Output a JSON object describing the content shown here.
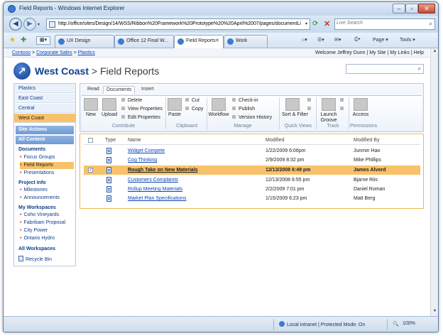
{
  "browser": {
    "window_title": "Field Reports - Windows Internet Explorer",
    "url": "http://office/sites/Design/14/WSS/Ribbon%20Framework%20Prototype%20%20April%2007/pages/documentLi",
    "search_placeholder": "Live Search",
    "tabs": [
      {
        "label": "UX Design"
      },
      {
        "label": "Office 12 Final W..."
      },
      {
        "label": "Field Reports"
      },
      {
        "label": "Work"
      }
    ],
    "commands": {
      "page": "Page ▾",
      "tools": "Tools ▾"
    },
    "status": {
      "zone": "Local intranet | Protected Mode: On",
      "zoom": "100%"
    }
  },
  "site": {
    "breadcrumb": [
      "Contoso",
      "Corporate Sales",
      "Plastics"
    ],
    "breadcrumb_sep": ">",
    "welcome": "Welcome Jeffrey Dunn | My Site | My Links | Help",
    "title_site": "West Coast",
    "title_page": " > Field Reports"
  },
  "leftnav": {
    "sites": [
      "Plastics",
      "East Coast",
      "Central",
      "West Coast"
    ],
    "site_actions": "Site Actions",
    "all_content": "All Content",
    "documents_head": "Documents",
    "documents": [
      "Focus Groups",
      "Field Reports",
      "Presentations"
    ],
    "project_head": "Project Info",
    "project": [
      "Milestones",
      "Announcements"
    ],
    "workspaces_head": "My Workspaces",
    "workspaces": [
      "Coho Vineyards",
      "Fabrikam Proposal",
      "City Power",
      "Ontario Hydro"
    ],
    "all_workspaces": "All Workspaces",
    "recycle_bin": "Recycle Bin"
  },
  "ribbon": {
    "tabs": [
      "Read",
      "Documents",
      "Insert"
    ],
    "new": "New",
    "upload": "Upload",
    "delete": "Delete",
    "view_properties": "View Properties",
    "edit_properties": "Edit Properties",
    "paste": "Paste",
    "cut": "Cut",
    "copy": "Copy",
    "workflow": "Workflow",
    "check_in": "Check-in",
    "publish": "Publish",
    "version_history": "Version History",
    "sort_filter": "Sort & Filter",
    "launch_groove": "Launch Groove",
    "access": "Access",
    "groups": [
      "Contribute",
      "Clipboard",
      "Manage",
      "Quick Views",
      "Track",
      "Permissions"
    ]
  },
  "list": {
    "columns": [
      "Type",
      "Name",
      "Modified",
      "Modified By"
    ],
    "rows": [
      {
        "name": "Widget Compete",
        "modified": "1/22/2009 6:06pm",
        "by": "Junmin Hao",
        "selected": false
      },
      {
        "name": "Cog Thinking",
        "modified": "2/9/2009 8:32 pm",
        "by": "Mike Phillips",
        "selected": false
      },
      {
        "name": "Rough Take on New Materials",
        "modified": "12/13/2008 6:49 pm",
        "by": "James Alvord",
        "selected": true
      },
      {
        "name": "Customers Complaints",
        "modified": "12/13/2008 6:55 pm",
        "by": "Bjarne Riis",
        "selected": false
      },
      {
        "name": "Rollup Meeting Materials",
        "modified": "2/2/2009 7:01 pm",
        "by": "Daniel Roman",
        "selected": false
      },
      {
        "name": "Market Plan Specifications",
        "modified": "1/15/2009 6:23 pm",
        "by": "Matt Berg",
        "selected": false
      }
    ]
  },
  "colors": {
    "accent_orange": "#f7c26a",
    "sharepoint_blue": "#0c3f8e",
    "link_blue": "#0b43b8"
  }
}
